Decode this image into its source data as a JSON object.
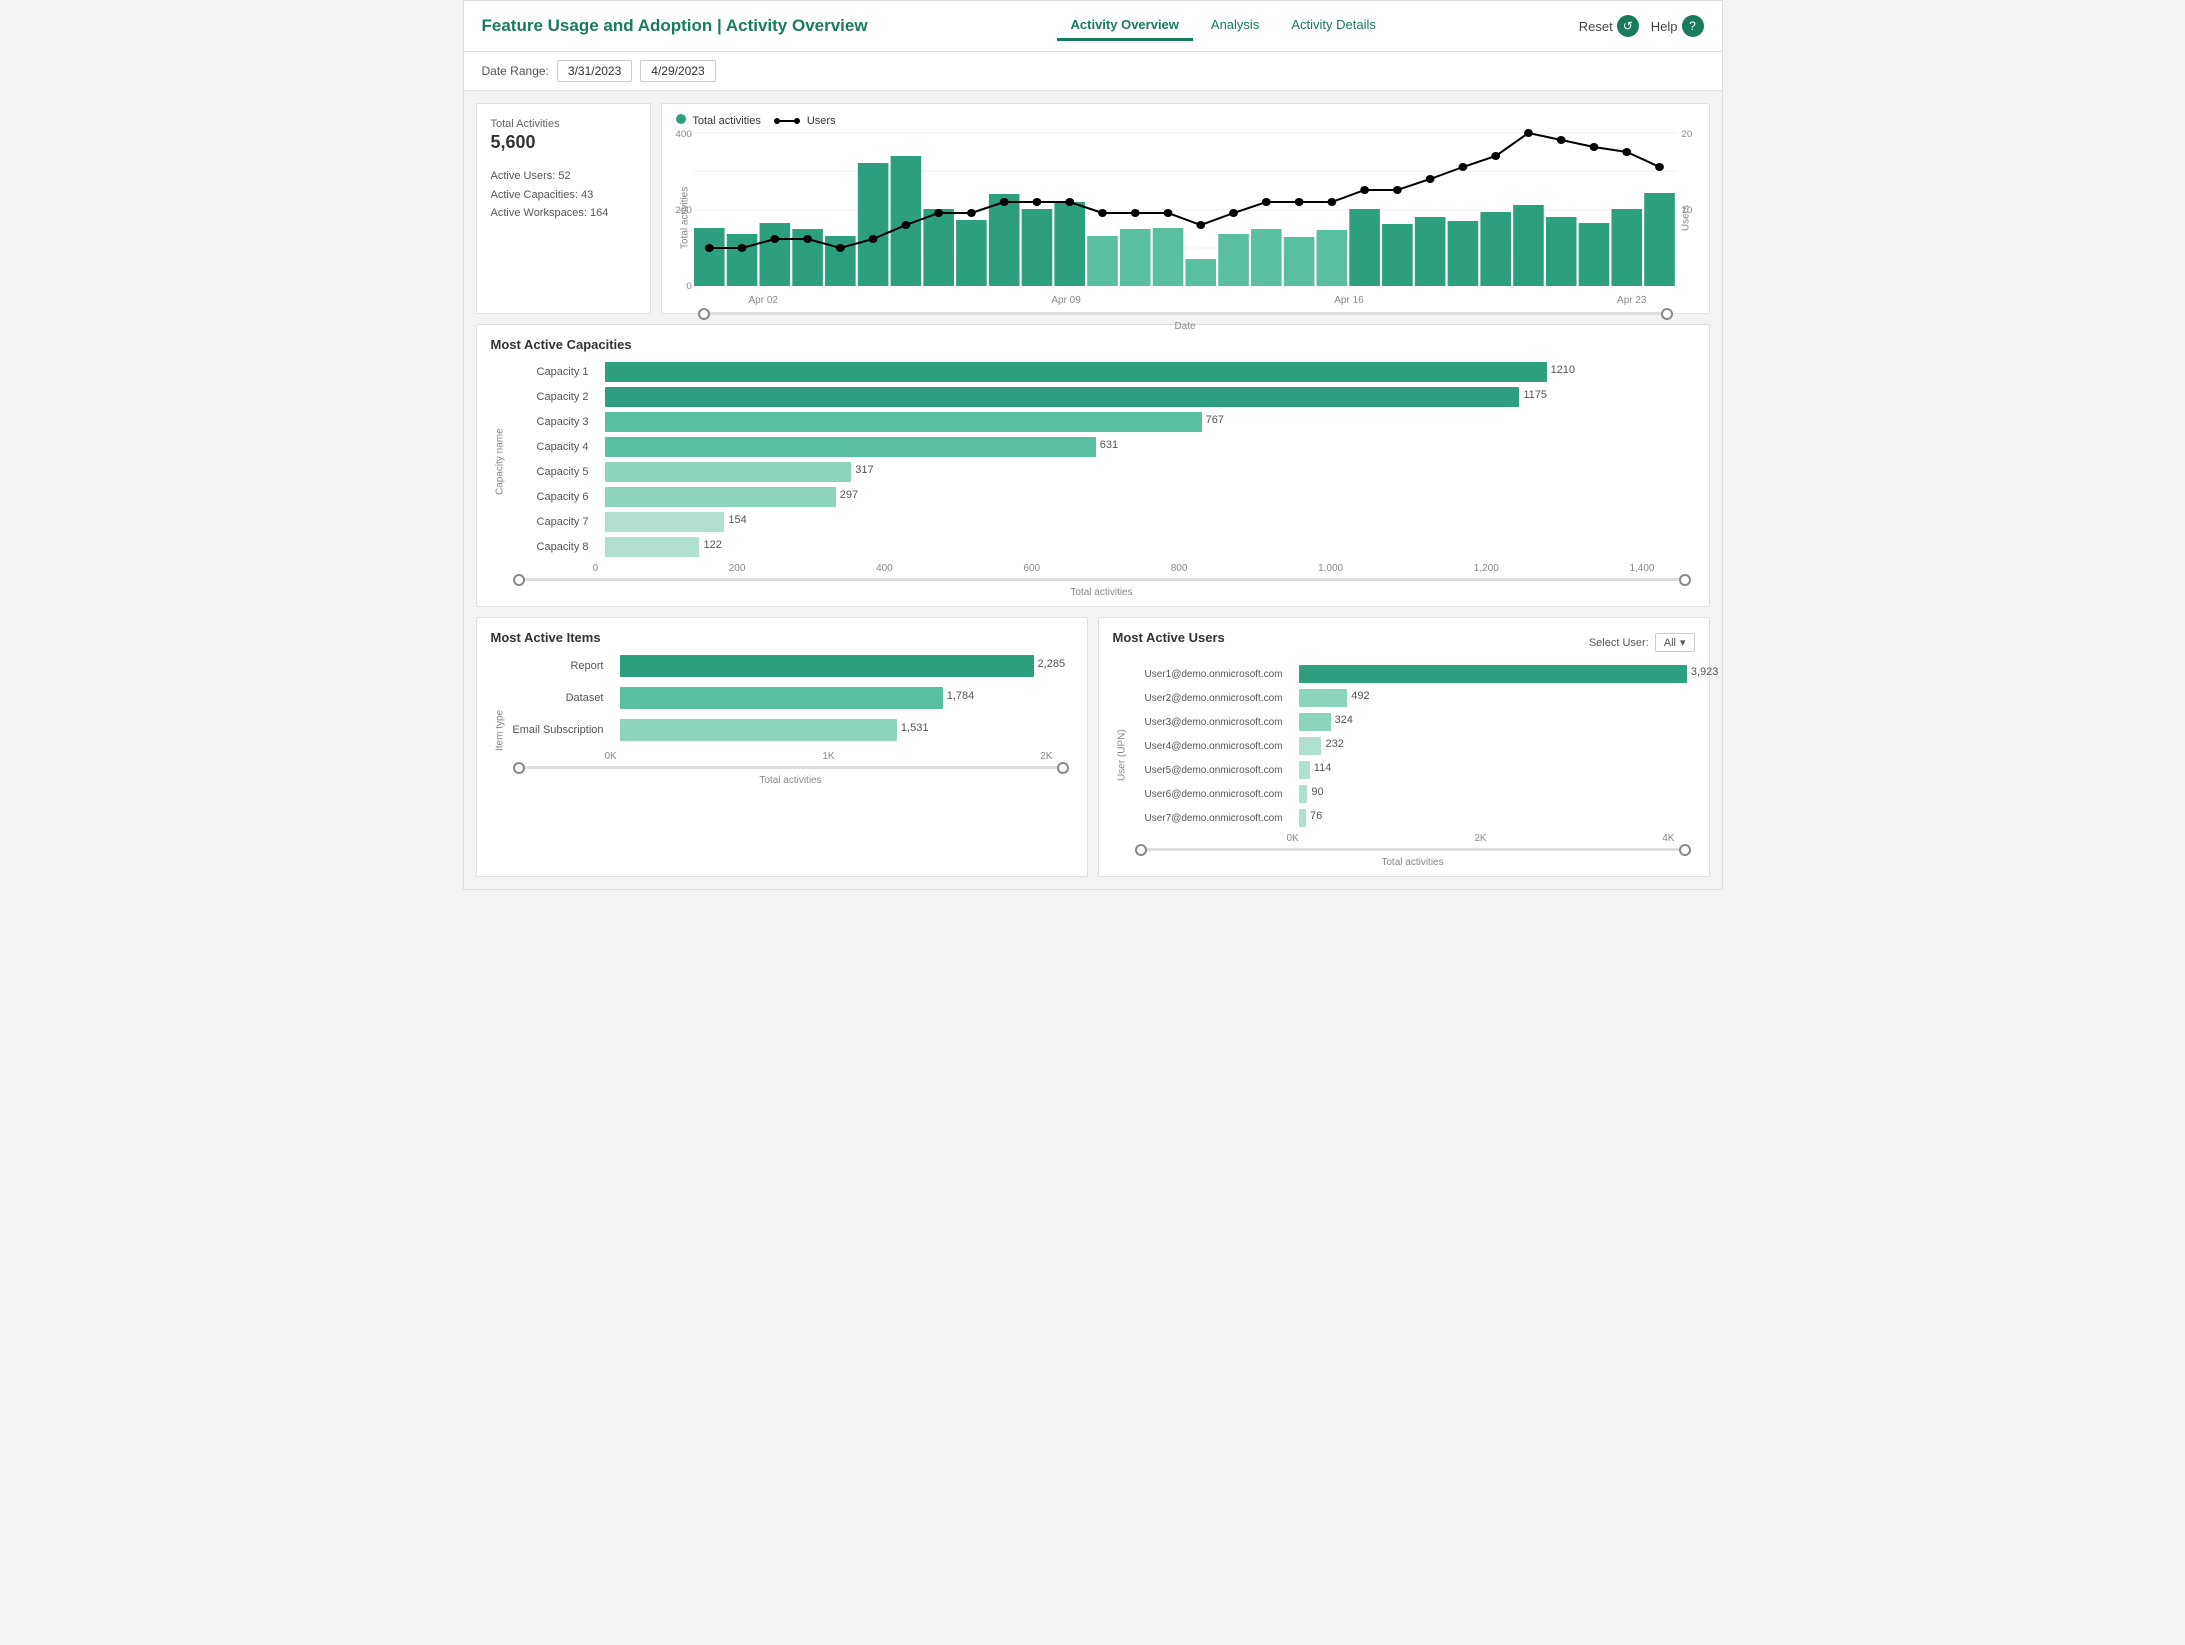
{
  "header": {
    "title": "Feature Usage and Adoption | Activity Overview",
    "nav_tabs": [
      {
        "id": "activity-overview",
        "label": "Activity Overview",
        "active": true
      },
      {
        "id": "analysis",
        "label": "Analysis",
        "active": false
      },
      {
        "id": "activity-details",
        "label": "Activity Details",
        "active": false
      }
    ],
    "actions": [
      {
        "id": "reset",
        "label": "Reset",
        "icon": "↺"
      },
      {
        "id": "help",
        "label": "Help",
        "icon": "?"
      }
    ]
  },
  "toolbar": {
    "date_range_label": "Date Range:",
    "date_start": "3/31/2023",
    "date_end": "4/29/2023"
  },
  "stats": {
    "total_activities_label": "Total Activities",
    "total_activities_value": "5,600",
    "active_users_label": "Active Users:",
    "active_users_value": "52",
    "active_capacities_label": "Active Capacities:",
    "active_capacities_value": "43",
    "active_workspaces_label": "Active Workspaces:",
    "active_workspaces_value": "164"
  },
  "activity_chart": {
    "legend_total": "Total activities",
    "legend_users": "Users",
    "y_axis_label_left": "Total activities",
    "y_axis_label_right": "Users",
    "x_axis_label": "Date",
    "x_labels": [
      "Apr 02",
      "Apr 09",
      "Apr 16",
      "Apr 23"
    ],
    "y_left_labels": [
      "0",
      "200",
      "400"
    ],
    "y_right_labels": [
      "10",
      "20"
    ],
    "bars": [
      {
        "date": "Mar31",
        "value": 160
      },
      {
        "date": "Apr01",
        "value": 140
      },
      {
        "date": "Apr02",
        "value": 170
      },
      {
        "date": "Apr03",
        "value": 155
      },
      {
        "date": "Apr04",
        "value": 130
      },
      {
        "date": "Apr05",
        "value": 320
      },
      {
        "date": "Apr06",
        "value": 340
      },
      {
        "date": "Apr07",
        "value": 200
      },
      {
        "date": "Apr08",
        "value": 175
      },
      {
        "date": "Apr09",
        "value": 240
      },
      {
        "date": "Apr10",
        "value": 200
      },
      {
        "date": "Apr11",
        "value": 220
      },
      {
        "date": "Apr12",
        "value": 130
      },
      {
        "date": "Apr13",
        "value": 155
      },
      {
        "date": "Apr14",
        "value": 160
      },
      {
        "date": "Apr15",
        "value": 70
      },
      {
        "date": "Apr16",
        "value": 140
      },
      {
        "date": "Apr17",
        "value": 155
      },
      {
        "date": "Apr18",
        "value": 135
      },
      {
        "date": "Apr19",
        "value": 150
      },
      {
        "date": "Apr20",
        "value": 200
      },
      {
        "date": "Apr21",
        "value": 165
      },
      {
        "date": "Apr22",
        "value": 185
      },
      {
        "date": "Apr23",
        "value": 175
      },
      {
        "date": "Apr24",
        "value": 195
      },
      {
        "date": "Apr25",
        "value": 210
      },
      {
        "date": "Apr26",
        "value": 185
      },
      {
        "date": "Apr27",
        "value": 170
      },
      {
        "date": "Apr28",
        "value": 200
      },
      {
        "date": "Apr29",
        "value": 230
      }
    ],
    "line": [
      6,
      6,
      7,
      7,
      6,
      7,
      8,
      9,
      9,
      10,
      10,
      10,
      9,
      9,
      9,
      8,
      9,
      10,
      10,
      10,
      11,
      11,
      12,
      13,
      14,
      18,
      19,
      17,
      16,
      13
    ]
  },
  "capacities": {
    "section_title": "Most Active Capacities",
    "y_axis_label": "Capacity name",
    "x_axis_label": "Total activities",
    "x_labels": [
      "0",
      "200",
      "400",
      "600",
      "800",
      "1,000",
      "1,200",
      "1,400"
    ],
    "max_value": 1400,
    "items": [
      {
        "name": "Capacity 1",
        "value": 1210,
        "color": "#2d9e7e"
      },
      {
        "name": "Capacity 2",
        "value": 1175,
        "color": "#2d9e7e"
      },
      {
        "name": "Capacity 3",
        "value": 767,
        "color": "#5abfa0"
      },
      {
        "name": "Capacity 4",
        "value": 631,
        "color": "#5abfa0"
      },
      {
        "name": "Capacity 5",
        "value": 317,
        "color": "#8dd4bc"
      },
      {
        "name": "Capacity 6",
        "value": 297,
        "color": "#8dd4bc"
      },
      {
        "name": "Capacity 7",
        "value": 154,
        "color": "#b2e0d0"
      },
      {
        "name": "Capacity 8",
        "value": 122,
        "color": "#b2e0d0"
      }
    ]
  },
  "items": {
    "section_title": "Most Active Items",
    "y_axis_label": "Item type",
    "x_axis_label": "Total activities",
    "x_labels": [
      "0K",
      "1K",
      "2K"
    ],
    "max_value": 2500,
    "items": [
      {
        "name": "Report",
        "value": 2285,
        "color": "#2d9e7e"
      },
      {
        "name": "Dataset",
        "value": 1784,
        "color": "#5abfa0"
      },
      {
        "name": "Email Subscription",
        "value": 1531,
        "color": "#8dd4bc"
      }
    ]
  },
  "users": {
    "section_title": "Most Active Users",
    "select_label": "Select User:",
    "select_value": "All",
    "y_axis_label": "User (UPN)",
    "x_axis_label": "Total activities",
    "x_labels": [
      "0K",
      "2K",
      "4K"
    ],
    "max_value": 4000,
    "items": [
      {
        "name": "User1@demo.onmicrosoft.com",
        "value": 3923,
        "color": "#2d9e7e"
      },
      {
        "name": "User2@demo.onmicrosoft.com",
        "value": 492,
        "color": "#8dd4bc"
      },
      {
        "name": "User3@demo.onmicrosoft.com",
        "value": 324,
        "color": "#8dd4bc"
      },
      {
        "name": "User4@demo.onmicrosoft.com",
        "value": 232,
        "color": "#b2e0d0"
      },
      {
        "name": "User5@demo.onmicrosoft.com",
        "value": 114,
        "color": "#b2e0d0"
      },
      {
        "name": "User6@demo.onmicrosoft.com",
        "value": 90,
        "color": "#b2e0d0"
      },
      {
        "name": "User7@demo.onmicrosoft.com",
        "value": 76,
        "color": "#b2e0d0"
      }
    ]
  }
}
